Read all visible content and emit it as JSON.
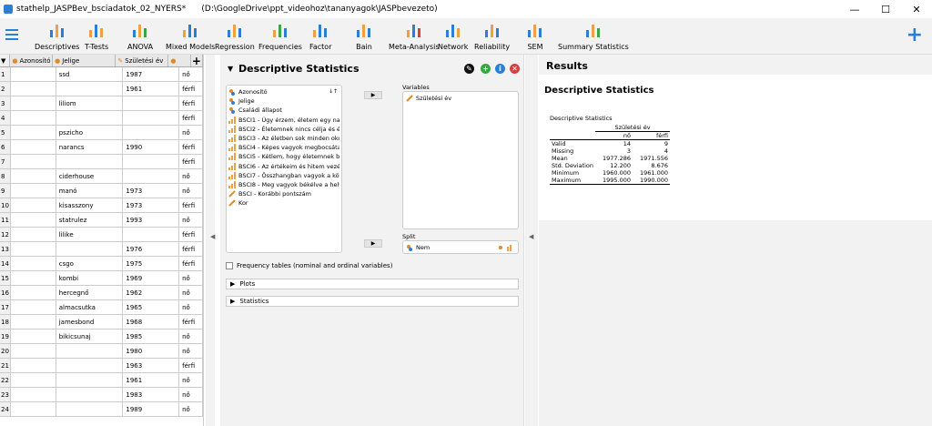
{
  "window": {
    "title": "stathelp_JASPBev_bsciadatok_02_NYERS*      (D:\\GoogleDrive\\ppt_videohoz\\tananyagok\\JASPbevezeto)",
    "min": "—",
    "max": "☐",
    "close": "✕"
  },
  "ribbon": {
    "buttons": [
      {
        "label": "Descriptives",
        "name": "descriptives"
      },
      {
        "label": "T-Tests",
        "name": "t-tests"
      },
      {
        "label": "ANOVA",
        "name": "anova"
      },
      {
        "label": "Mixed Models",
        "name": "mixed-models"
      },
      {
        "label": "Regression",
        "name": "regression"
      },
      {
        "label": "Frequencies",
        "name": "frequencies"
      },
      {
        "label": "Factor",
        "name": "factor"
      },
      {
        "label": "Bain",
        "name": "bain"
      },
      {
        "label": "Meta-Analysis",
        "name": "meta-analysis"
      },
      {
        "label": "Network",
        "name": "network"
      },
      {
        "label": "Reliability",
        "name": "reliability"
      },
      {
        "label": "SEM",
        "name": "sem"
      },
      {
        "label": "Summary Statistics",
        "name": "summary-statistics"
      }
    ],
    "add": "+"
  },
  "data": {
    "headers": [
      "Azonosító",
      "Jelige",
      "Születési év",
      ""
    ],
    "add_col": "+",
    "rows": [
      [
        "1",
        "",
        "ssd",
        "1987",
        "nő"
      ],
      [
        "2",
        "",
        "",
        "1961",
        "férfi"
      ],
      [
        "3",
        "",
        "liliom",
        "",
        "férfi"
      ],
      [
        "4",
        "",
        "",
        "",
        "férfi"
      ],
      [
        "5",
        "",
        "pszicho",
        "",
        "nő"
      ],
      [
        "6",
        "",
        "narancs",
        "1990",
        "férfi"
      ],
      [
        "7",
        "",
        "",
        "",
        "férfi"
      ],
      [
        "8",
        "",
        "ciderhouse",
        "",
        "nő"
      ],
      [
        "9",
        "",
        "manó",
        "1973",
        "nő"
      ],
      [
        "10",
        "",
        "kisasszony",
        "1973",
        "férfi"
      ],
      [
        "11",
        "",
        "statrulez",
        "1993",
        "nő"
      ],
      [
        "12",
        "",
        "lilike",
        "",
        "férfi"
      ],
      [
        "13",
        "",
        "",
        "1976",
        "férfi"
      ],
      [
        "14",
        "",
        "csgo",
        "1975",
        "férfi"
      ],
      [
        "15",
        "",
        "kombi",
        "1969",
        "nő"
      ],
      [
        "16",
        "",
        "hercegnő",
        "1962",
        "nő"
      ],
      [
        "17",
        "",
        "almacsutka",
        "1965",
        "nő"
      ],
      [
        "18",
        "",
        "jamesbond",
        "1968",
        "férfi"
      ],
      [
        "19",
        "",
        "bikicsunaj",
        "1985",
        "nő"
      ],
      [
        "20",
        "",
        "",
        "1980",
        "nő"
      ],
      [
        "21",
        "",
        "",
        "1963",
        "férfi"
      ],
      [
        "22",
        "",
        "",
        "1961",
        "nő"
      ],
      [
        "23",
        "",
        "",
        "1983",
        "nő"
      ],
      [
        "24",
        "",
        "",
        "1989",
        "nő"
      ]
    ]
  },
  "analysis": {
    "title": "Descriptive Statistics",
    "variables_label": "Variables",
    "split_label": "Split",
    "sort_icon": "↓↑",
    "arrow": "▶",
    "list": [
      {
        "label": "Azonosító",
        "type": "nominal"
      },
      {
        "label": "Jelige",
        "type": "nominal"
      },
      {
        "label": "Családi állapot",
        "type": "nominal"
      },
      {
        "label": "BSCI1 - Úgy érzem, életem egy na...",
        "type": "ordinal"
      },
      {
        "label": "BSCI2 - Életemnek nincs célja és ér...",
        "type": "ordinal"
      },
      {
        "label": "BSCI3 - Az életben sok minden oko...",
        "type": "ordinal"
      },
      {
        "label": "BSCI4 - Képes vagyok megbocsáta...",
        "type": "ordinal"
      },
      {
        "label": "BSCI5 - Kétlem, hogy életemnek b...",
        "type": "ordinal"
      },
      {
        "label": "BSCI6 - Az értékeim és hitem vezér...",
        "type": "ordinal"
      },
      {
        "label": "BSCI7 - Összhangban vagyok a körü...",
        "type": "ordinal"
      },
      {
        "label": "BSCI8 - Meg vagyok békélve a hely...",
        "type": "ordinal"
      },
      {
        "label": "BSCI - Korábbi pontszám",
        "type": "scale"
      },
      {
        "label": "Kor",
        "type": "scale"
      }
    ],
    "variables": [
      "Születési év"
    ],
    "split": [
      "Nem"
    ],
    "freq_label": "Frequency tables (nominal and ordinal variables)",
    "plots": "Plots",
    "statistics": "Statistics"
  },
  "results": {
    "title": "Results",
    "heading": "Descriptive Statistics",
    "table_caption": "Descriptive Statistics",
    "col_group": "Születési év",
    "cols": [
      "nő",
      "férfi"
    ],
    "rows": [
      {
        "label": "Valid",
        "v": [
          "14",
          "9"
        ]
      },
      {
        "label": "Missing",
        "v": [
          "3",
          "4"
        ]
      },
      {
        "label": "Mean",
        "v": [
          "1977.286",
          "1971.556"
        ]
      },
      {
        "label": "Std. Deviation",
        "v": [
          "12.200",
          "8.676"
        ]
      },
      {
        "label": "Minimum",
        "v": [
          "1960.000",
          "1961.000"
        ]
      },
      {
        "label": "Maximum",
        "v": [
          "1995.000",
          "1990.000"
        ]
      }
    ]
  },
  "colors": {
    "accent": "#2d7fd6",
    "ribbon": "#f2f2f2"
  }
}
